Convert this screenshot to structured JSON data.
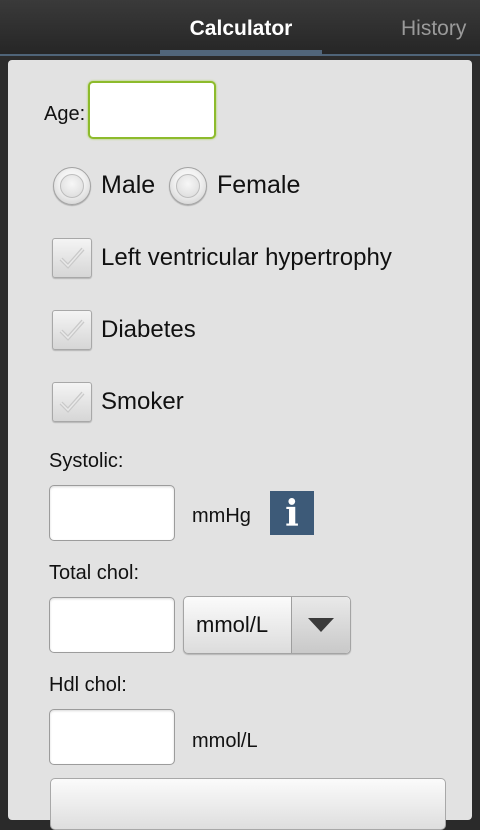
{
  "tabs": [
    {
      "label": "Calculator",
      "active": true
    },
    {
      "label": "History",
      "active": false
    }
  ],
  "form": {
    "age_label": "Age:",
    "age_value": "",
    "sex_options": [
      "Male",
      "Female"
    ],
    "checkboxes": [
      {
        "label": "Left ventricular hypertrophy",
        "checked": true
      },
      {
        "label": "Diabetes",
        "checked": true
      },
      {
        "label": "Smoker",
        "checked": true
      }
    ],
    "systolic_label": "Systolic:",
    "systolic_value": "",
    "systolic_unit": "mmHg",
    "info_icon": "info-icon",
    "total_chol_label": "Total chol:",
    "total_chol_value": "",
    "total_chol_unit_selected": "mmol/L",
    "hdl_chol_label": "Hdl chol:",
    "hdl_chol_value": "",
    "hdl_chol_unit": "mmol/L"
  },
  "colors": {
    "accent": "#51667b",
    "focus": "#8dbb2c",
    "info_button": "#3d5a78"
  }
}
